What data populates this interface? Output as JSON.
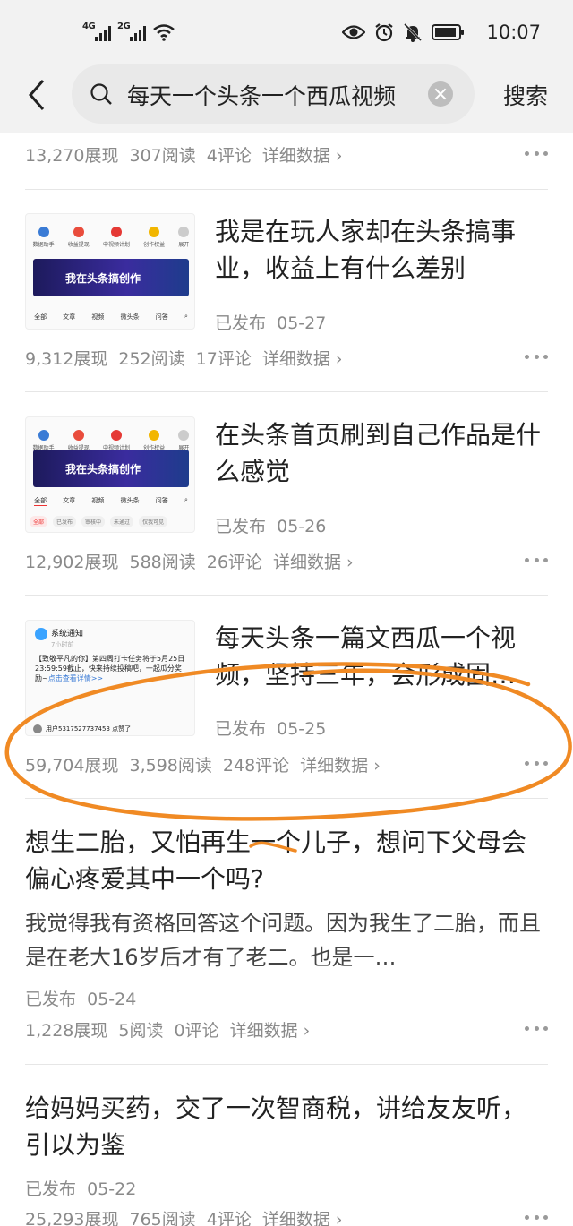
{
  "status_bar": {
    "net1": "4G",
    "net2": "2G",
    "time": "10:07"
  },
  "search": {
    "query": "每天一个头条一个西瓜视频",
    "submit_label": "搜索"
  },
  "feed": {
    "top_stats": {
      "views": "13,270展现",
      "reads": "307阅读",
      "comments": "4评论",
      "detail": "详细数据"
    },
    "items": [
      {
        "title": "我是在玩人家却在头条搞事业，收益上有什么差别",
        "status": "已发布",
        "date": "05-27",
        "views": "9,312展现",
        "reads": "252阅读",
        "comments": "17评论",
        "detail": "详细数据",
        "thumb": {
          "icons": [
            "数据助手",
            "收益提现",
            "中视频计划",
            "创作权益",
            "展开"
          ],
          "banner": "我在头条搞创作",
          "tabs": [
            "全部",
            "文章",
            "视频",
            "微头条",
            "问答"
          ]
        }
      },
      {
        "title": "在头条首页刷到自己作品是什么感觉",
        "status": "已发布",
        "date": "05-26",
        "views": "12,902展现",
        "reads": "588阅读",
        "comments": "26评论",
        "detail": "详细数据",
        "thumb": {
          "icons": [
            "数据助手",
            "收益提现",
            "中视频计划",
            "创作权益",
            "展开"
          ],
          "banner": "我在头条搞创作",
          "tabs": [
            "全部",
            "文章",
            "视频",
            "微头条",
            "问答"
          ],
          "subtabs": [
            "全部",
            "已发布",
            "审核中",
            "未通过",
            "仅我可见"
          ]
        }
      },
      {
        "title": "每天头条一篇文西瓜一个视频，坚持三年，会形成固…",
        "status": "已发布",
        "date": "05-25",
        "views": "59,704展现",
        "reads": "3,598阅读",
        "comments": "248评论",
        "detail": "详细数据",
        "thumb": {
          "notify_title": "系统通知",
          "notify_time": "7小时前",
          "notify_body": "【致敬平凡的你】第四周打卡任务将于5月25日23:59:59截止，快来持续投稿吧，一起瓜分奖励~",
          "notify_link": "点击查看详情>>",
          "user_line": "用户5317527737453 点赞了"
        }
      },
      {
        "title": "想生二胎，又怕再生一个儿子，想问下父母会偏心疼爱其中一个吗?",
        "summary": "我觉得我有资格回答这个问题。因为我生了二胎，而且是在老大16岁后才有了老二。也是一…",
        "status": "已发布",
        "date": "05-24",
        "views": "1,228展现",
        "reads": "5阅读",
        "comments": "0评论",
        "detail": "详细数据"
      },
      {
        "title": "给妈妈买药，交了一次智商税，讲给友友听，引以为鉴",
        "status": "已发布",
        "date": "05-22",
        "views": "25,293展现",
        "reads": "765阅读",
        "comments": "4评论",
        "detail": "详细数据"
      }
    ]
  },
  "colors": {
    "annotation": "#f08a24",
    "muted_text": "#8a8a8a",
    "header_bg": "#f2f2f2"
  }
}
